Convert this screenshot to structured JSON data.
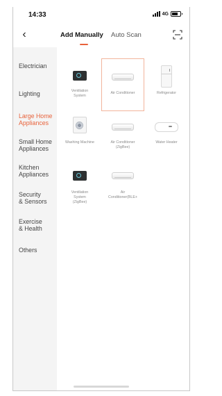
{
  "status_bar": {
    "time": "14:33",
    "network": "4G",
    "icons": [
      "signal-icon",
      "battery-icon"
    ]
  },
  "header": {
    "back_icon": "chevron-left-icon",
    "tabs": [
      {
        "label": "Add Manually",
        "active": true
      },
      {
        "label": "Auto Scan",
        "active": false
      }
    ],
    "scan_icon": "scan-frame-icon"
  },
  "colors": {
    "accent": "#e8623b",
    "sidebar_bg": "#f4f4f4",
    "label_gray": "#8a8a8a"
  },
  "sidebar": {
    "items": [
      {
        "label": "Electrician",
        "active": false
      },
      {
        "label": "Lighting",
        "active": false
      },
      {
        "label": "Large Home\nAppliances",
        "active": true
      },
      {
        "label": "Small Home\nAppliances",
        "active": false
      },
      {
        "label": "Kitchen\nAppliances",
        "active": false
      },
      {
        "label": "Security\n& Sensors",
        "active": false
      },
      {
        "label": "Exercise\n& Health",
        "active": false
      },
      {
        "label": "Others",
        "active": false
      }
    ]
  },
  "devices": [
    {
      "label": "Ventilation\nSystem",
      "icon": "ventilation-icon",
      "selected": false
    },
    {
      "label": "Air Conditioner",
      "icon": "air-conditioner-icon",
      "selected": true
    },
    {
      "label": "Refrigerator",
      "icon": "refrigerator-icon",
      "selected": false
    },
    {
      "label": "Washing Machine",
      "icon": "washing-machine-icon",
      "selected": false
    },
    {
      "label": "Air Conditioner\n(ZigBee)",
      "icon": "air-conditioner-icon",
      "selected": false
    },
    {
      "label": "Water Heater",
      "icon": "water-heater-icon",
      "selected": false
    },
    {
      "label": "Ventilation\nSystem\n(ZigBee)",
      "icon": "ventilation-icon",
      "selected": false
    },
    {
      "label": "Air\nConditioner(BLE+",
      "icon": "air-conditioner-icon",
      "selected": false
    }
  ]
}
